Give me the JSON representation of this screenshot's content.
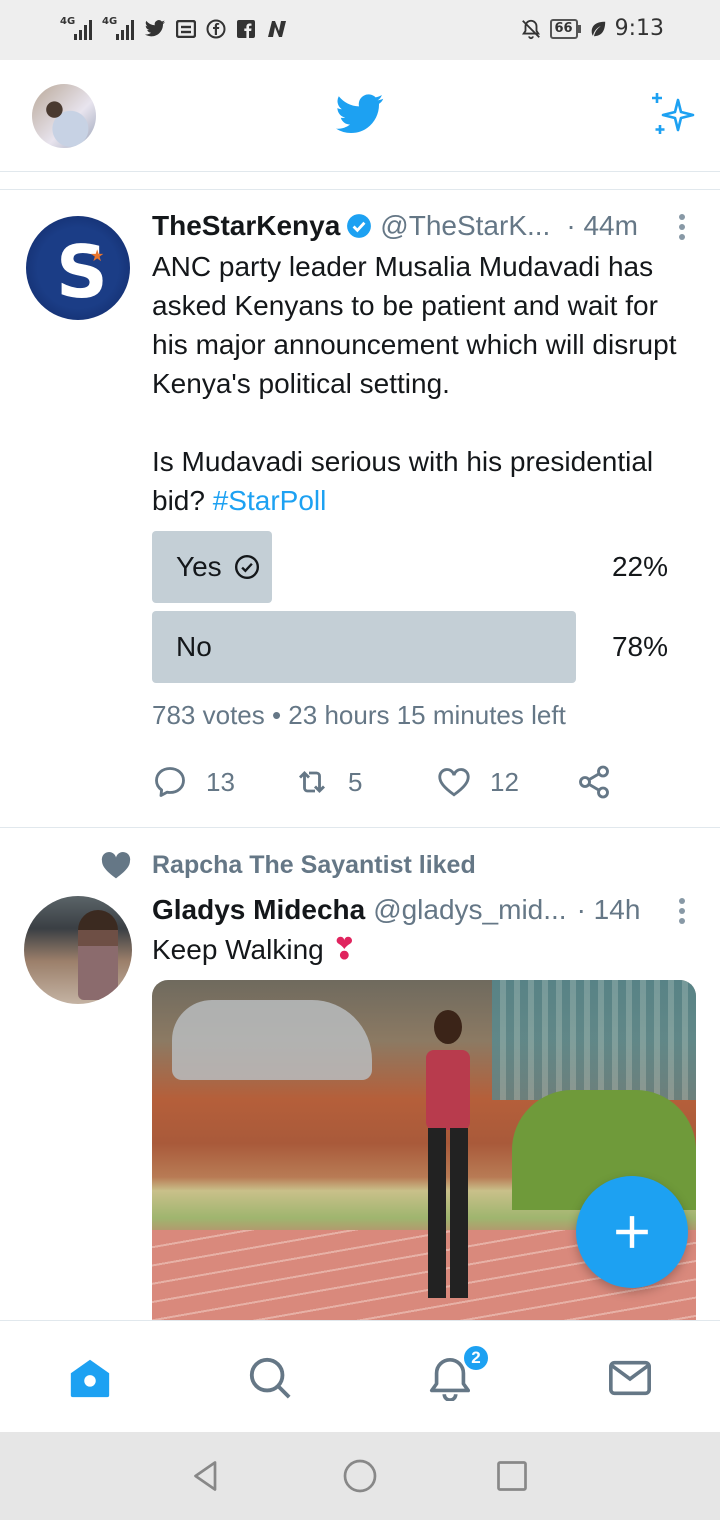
{
  "status_bar": {
    "network_1": "4G",
    "network_2": "4G",
    "battery": "66",
    "time": "9:13",
    "icons": [
      "signal-icon",
      "signal-icon",
      "twitter-icon",
      "message-icon",
      "facebook-icon",
      "facebook-icon",
      "n-app-icon",
      "mute-icon",
      "battery-icon",
      "leaf-icon"
    ]
  },
  "top_bar": {
    "icons": [
      "profile-avatar",
      "twitter-bird-icon",
      "sparkle-icon"
    ]
  },
  "tweet1": {
    "name": "TheStarKenya",
    "handle": "@TheStarK...",
    "time": "· 44m",
    "text_p1": "ANC party leader Musalia Mudavadi has asked Kenyans to be patient and wait for his major announcement which will disrupt Kenya's political setting.",
    "text_p2_pre": "Is Mudavadi serious with his presidential bid?",
    "hashtag": "#StarPoll",
    "poll": {
      "options": [
        {
          "label": "Yes",
          "percent_text": "22%",
          "percent": 22,
          "voted": true
        },
        {
          "label": "No",
          "percent_text": "78%",
          "percent": 78,
          "voted": false
        }
      ],
      "meta": "783 votes • 23 hours 15 minutes left"
    },
    "actions": {
      "replies": "13",
      "retweets": "5",
      "likes": "12"
    }
  },
  "tweet2": {
    "liked_by": "Rapcha The Sayantist liked",
    "name": "Gladys Midecha",
    "handle": "@gladys_mid...",
    "time": "· 14h",
    "text": "Keep Walking",
    "emoji": "❣"
  },
  "bottom_nav": {
    "notifications_badge": "2",
    "items": [
      "home-icon",
      "search-icon",
      "notifications-icon",
      "messages-icon"
    ]
  },
  "colors": {
    "accent": "#1da1f2",
    "text": "#14171a",
    "secondary": "#657786",
    "poll_fill": "#c4cfd6"
  }
}
